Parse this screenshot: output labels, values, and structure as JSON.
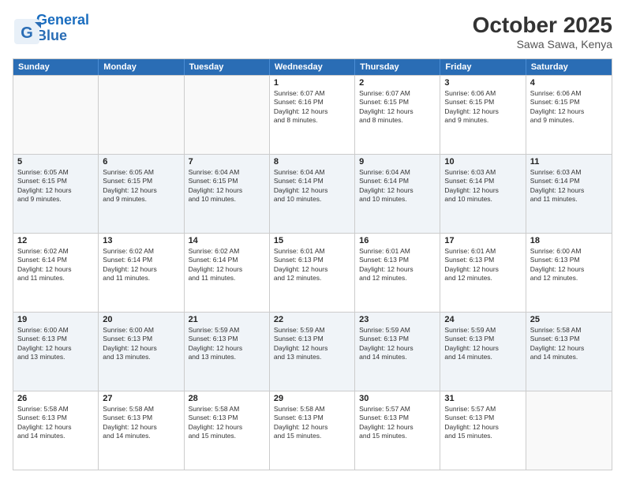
{
  "header": {
    "logo_line1": "General",
    "logo_line2": "Blue",
    "month_title": "October 2025",
    "location": "Sawa Sawa, Kenya"
  },
  "days_of_week": [
    "Sunday",
    "Monday",
    "Tuesday",
    "Wednesday",
    "Thursday",
    "Friday",
    "Saturday"
  ],
  "weeks": [
    [
      {
        "day": "",
        "info": ""
      },
      {
        "day": "",
        "info": ""
      },
      {
        "day": "",
        "info": ""
      },
      {
        "day": "1",
        "info": "Sunrise: 6:07 AM\nSunset: 6:16 PM\nDaylight: 12 hours\nand 8 minutes."
      },
      {
        "day": "2",
        "info": "Sunrise: 6:07 AM\nSunset: 6:15 PM\nDaylight: 12 hours\nand 8 minutes."
      },
      {
        "day": "3",
        "info": "Sunrise: 6:06 AM\nSunset: 6:15 PM\nDaylight: 12 hours\nand 9 minutes."
      },
      {
        "day": "4",
        "info": "Sunrise: 6:06 AM\nSunset: 6:15 PM\nDaylight: 12 hours\nand 9 minutes."
      }
    ],
    [
      {
        "day": "5",
        "info": "Sunrise: 6:05 AM\nSunset: 6:15 PM\nDaylight: 12 hours\nand 9 minutes."
      },
      {
        "day": "6",
        "info": "Sunrise: 6:05 AM\nSunset: 6:15 PM\nDaylight: 12 hours\nand 9 minutes."
      },
      {
        "day": "7",
        "info": "Sunrise: 6:04 AM\nSunset: 6:15 PM\nDaylight: 12 hours\nand 10 minutes."
      },
      {
        "day": "8",
        "info": "Sunrise: 6:04 AM\nSunset: 6:14 PM\nDaylight: 12 hours\nand 10 minutes."
      },
      {
        "day": "9",
        "info": "Sunrise: 6:04 AM\nSunset: 6:14 PM\nDaylight: 12 hours\nand 10 minutes."
      },
      {
        "day": "10",
        "info": "Sunrise: 6:03 AM\nSunset: 6:14 PM\nDaylight: 12 hours\nand 10 minutes."
      },
      {
        "day": "11",
        "info": "Sunrise: 6:03 AM\nSunset: 6:14 PM\nDaylight: 12 hours\nand 11 minutes."
      }
    ],
    [
      {
        "day": "12",
        "info": "Sunrise: 6:02 AM\nSunset: 6:14 PM\nDaylight: 12 hours\nand 11 minutes."
      },
      {
        "day": "13",
        "info": "Sunrise: 6:02 AM\nSunset: 6:14 PM\nDaylight: 12 hours\nand 11 minutes."
      },
      {
        "day": "14",
        "info": "Sunrise: 6:02 AM\nSunset: 6:14 PM\nDaylight: 12 hours\nand 11 minutes."
      },
      {
        "day": "15",
        "info": "Sunrise: 6:01 AM\nSunset: 6:13 PM\nDaylight: 12 hours\nand 12 minutes."
      },
      {
        "day": "16",
        "info": "Sunrise: 6:01 AM\nSunset: 6:13 PM\nDaylight: 12 hours\nand 12 minutes."
      },
      {
        "day": "17",
        "info": "Sunrise: 6:01 AM\nSunset: 6:13 PM\nDaylight: 12 hours\nand 12 minutes."
      },
      {
        "day": "18",
        "info": "Sunrise: 6:00 AM\nSunset: 6:13 PM\nDaylight: 12 hours\nand 12 minutes."
      }
    ],
    [
      {
        "day": "19",
        "info": "Sunrise: 6:00 AM\nSunset: 6:13 PM\nDaylight: 12 hours\nand 13 minutes."
      },
      {
        "day": "20",
        "info": "Sunrise: 6:00 AM\nSunset: 6:13 PM\nDaylight: 12 hours\nand 13 minutes."
      },
      {
        "day": "21",
        "info": "Sunrise: 5:59 AM\nSunset: 6:13 PM\nDaylight: 12 hours\nand 13 minutes."
      },
      {
        "day": "22",
        "info": "Sunrise: 5:59 AM\nSunset: 6:13 PM\nDaylight: 12 hours\nand 13 minutes."
      },
      {
        "day": "23",
        "info": "Sunrise: 5:59 AM\nSunset: 6:13 PM\nDaylight: 12 hours\nand 14 minutes."
      },
      {
        "day": "24",
        "info": "Sunrise: 5:59 AM\nSunset: 6:13 PM\nDaylight: 12 hours\nand 14 minutes."
      },
      {
        "day": "25",
        "info": "Sunrise: 5:58 AM\nSunset: 6:13 PM\nDaylight: 12 hours\nand 14 minutes."
      }
    ],
    [
      {
        "day": "26",
        "info": "Sunrise: 5:58 AM\nSunset: 6:13 PM\nDaylight: 12 hours\nand 14 minutes."
      },
      {
        "day": "27",
        "info": "Sunrise: 5:58 AM\nSunset: 6:13 PM\nDaylight: 12 hours\nand 14 minutes."
      },
      {
        "day": "28",
        "info": "Sunrise: 5:58 AM\nSunset: 6:13 PM\nDaylight: 12 hours\nand 15 minutes."
      },
      {
        "day": "29",
        "info": "Sunrise: 5:58 AM\nSunset: 6:13 PM\nDaylight: 12 hours\nand 15 minutes."
      },
      {
        "day": "30",
        "info": "Sunrise: 5:57 AM\nSunset: 6:13 PM\nDaylight: 12 hours\nand 15 minutes."
      },
      {
        "day": "31",
        "info": "Sunrise: 5:57 AM\nSunset: 6:13 PM\nDaylight: 12 hours\nand 15 minutes."
      },
      {
        "day": "",
        "info": ""
      }
    ]
  ]
}
